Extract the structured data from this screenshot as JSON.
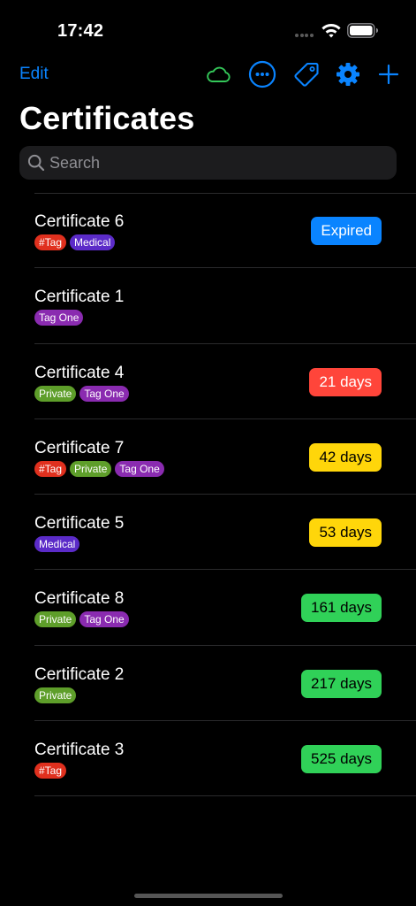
{
  "status_bar": {
    "time": "17:42"
  },
  "toolbar": {
    "edit_label": "Edit",
    "icons": [
      "cloud-icon",
      "more-icon",
      "tag-icon",
      "gear-icon",
      "plus-icon"
    ]
  },
  "page": {
    "title": "Certificates"
  },
  "search": {
    "placeholder": "Search",
    "value": ""
  },
  "colors": {
    "accent": "#0a84ff",
    "cloud": "#34c759",
    "badge_blue": "#0a84ff",
    "badge_red": "#ff453a",
    "badge_yellow": "#ffd60a",
    "badge_green": "#30d158",
    "tag_hash": "#e0301e",
    "tag_medical": "#5b2bc8",
    "tag_tag_one": "#8a2bb0",
    "tag_private": "#5e9e2a"
  },
  "certificates": [
    {
      "name": "Certificate 6",
      "tags": [
        "#Tag",
        "Medical"
      ],
      "badge": "Expired",
      "badge_color": "blue"
    },
    {
      "name": "Certificate 1",
      "tags": [
        "Tag One"
      ],
      "badge": "",
      "badge_color": ""
    },
    {
      "name": "Certificate 4",
      "tags": [
        "Private",
        "Tag One"
      ],
      "badge": "21 days",
      "badge_color": "red"
    },
    {
      "name": "Certificate 7",
      "tags": [
        "#Tag",
        "Private",
        "Tag One"
      ],
      "badge": "42 days",
      "badge_color": "yellow"
    },
    {
      "name": "Certificate 5",
      "tags": [
        "Medical"
      ],
      "badge": "53 days",
      "badge_color": "yellow"
    },
    {
      "name": "Certificate 8",
      "tags": [
        "Private",
        "Tag One"
      ],
      "badge": "161 days",
      "badge_color": "green"
    },
    {
      "name": "Certificate 2",
      "tags": [
        "Private"
      ],
      "badge": "217 days",
      "badge_color": "green"
    },
    {
      "name": "Certificate 3",
      "tags": [
        "#Tag"
      ],
      "badge": "525 days",
      "badge_color": "green"
    }
  ]
}
